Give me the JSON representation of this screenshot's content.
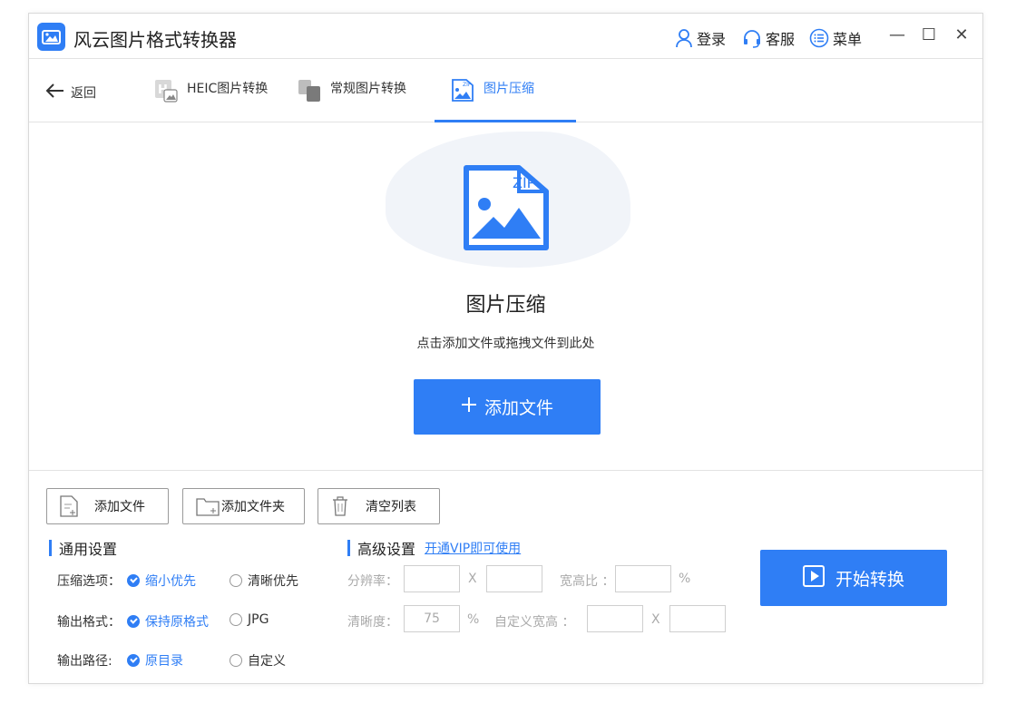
{
  "app": {
    "title": "风云图片格式转换器"
  },
  "titlebar": {
    "login": "登录",
    "service": "客服",
    "menu": "菜单",
    "minimize": "—",
    "maximize": "☐",
    "close": "✕"
  },
  "nav": {
    "back": "返回",
    "tabs": [
      {
        "label": "HEIC图片转换"
      },
      {
        "label": "常规图片转换"
      },
      {
        "label": "图片压缩"
      }
    ]
  },
  "dropzone": {
    "zip_text": "ZIP",
    "title": "图片压缩",
    "hint": "点击添加文件或拖拽文件到此处",
    "add_button": "添加文件"
  },
  "toolbar": {
    "add_file": "添加文件",
    "add_folder": "添加文件夹",
    "clear_list": "清空列表"
  },
  "general": {
    "title": "通用设置",
    "compress_label": "压缩选项：",
    "compress_options": [
      "缩小优先",
      "清晰优先"
    ],
    "format_label": "输出格式：",
    "format_options": [
      "保持原格式",
      "JPG"
    ],
    "path_label": "输出路径:",
    "path_options": [
      "原目录",
      "自定义"
    ]
  },
  "advanced": {
    "title": "高级设置",
    "vip_link": "开通VIP即可使用",
    "resolution_label": "分辨率：",
    "x1": "X",
    "ratio_label": "宽高比 ：",
    "percent1": "%",
    "clarity_label": "清晰度：",
    "clarity_value": "75",
    "percent2": "%",
    "custom_label": "自定义宽高 ：",
    "x2": "X"
  },
  "start_button": "开始转换",
  "colors": {
    "accent": "#2f7ef5"
  }
}
